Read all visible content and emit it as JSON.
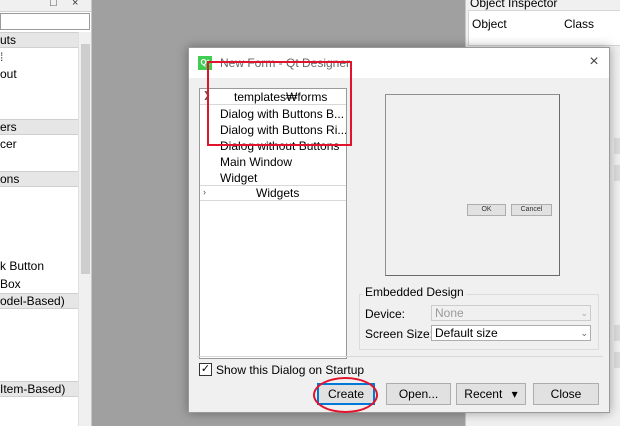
{
  "left_panel": {
    "top_buttons": [
      "□",
      "×"
    ],
    "categories": [
      {
        "label": "uts"
      },
      {
        "label": "ers"
      },
      {
        "label": "ons"
      },
      {
        "label": "odel-Based)"
      },
      {
        "label": "Item-Based)"
      }
    ],
    "items": [
      "out",
      "cer",
      "k Button",
      "Box"
    ]
  },
  "object_inspector": {
    "title": "Object Inspector",
    "col_object": "Object",
    "col_class": "Class"
  },
  "dialog": {
    "icon_text": "Qt",
    "title": "New Form - Qt Designer",
    "close_glyph": "×",
    "tree": {
      "group1": "templates₩forms",
      "group2": "Widgets",
      "items": [
        "Dialog with Buttons B...",
        "Dialog with Buttons Ri...",
        "Dialog without Buttons",
        "Main Window",
        "Widget"
      ]
    },
    "preview": {
      "ok_label": "OK",
      "cancel_label": "Cancel"
    },
    "embedded": {
      "group_title": "Embedded Design",
      "device_label": "Device:",
      "device_value": "None",
      "screen_size_label": "Screen Size:",
      "screen_size_value": "Default size"
    },
    "show_on_startup": {
      "label": "Show this Dialog on Startup",
      "checked_glyph": "✓"
    },
    "buttons": {
      "create": "Create",
      "open": "Open...",
      "recent": "Recent",
      "recent_arrow": "▾",
      "close": "Close"
    }
  }
}
